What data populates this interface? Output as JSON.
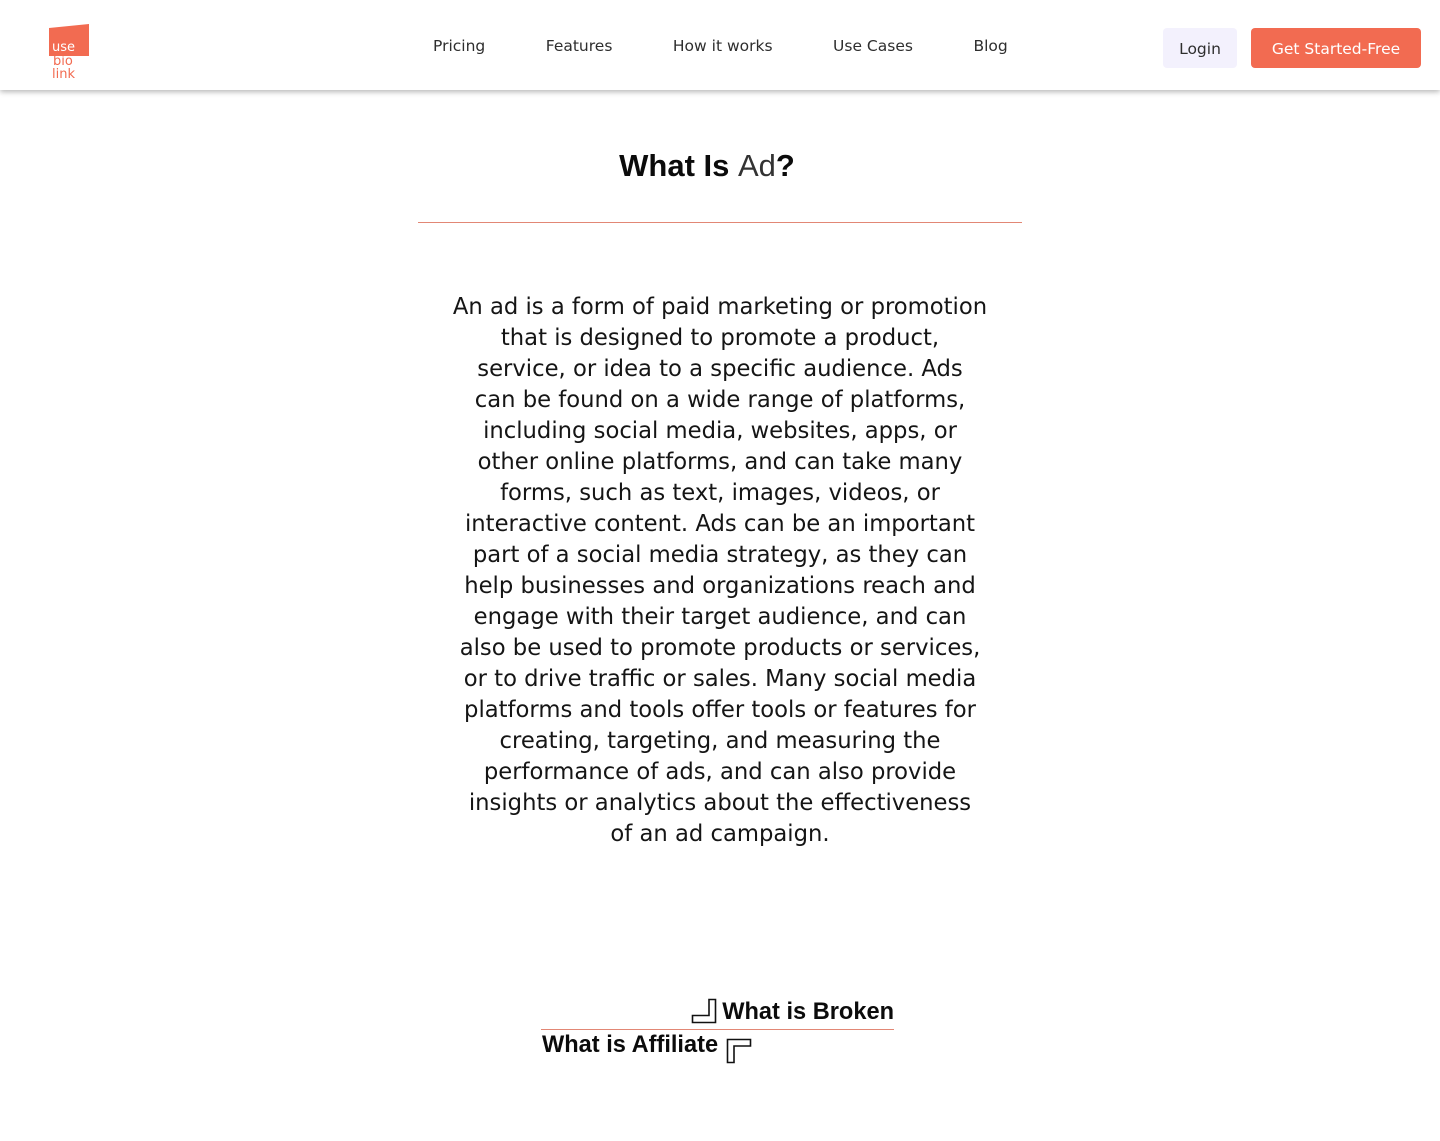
{
  "header": {
    "logo": {
      "line1": "use",
      "line2": "bio",
      "line3": "link"
    },
    "nav": [
      {
        "label": "Pricing"
      },
      {
        "label": "Features"
      },
      {
        "label": "How it works"
      },
      {
        "label": "Use Cases"
      },
      {
        "label": "Blog"
      }
    ],
    "login_label": "Login",
    "cta_label": "Get Started-Free"
  },
  "article": {
    "title": {
      "prefix": "What Is ",
      "term": "Ad",
      "suffix": "?"
    },
    "body_lines": [
      "An ad is a form of paid marketing or promotion",
      "that is designed to promote a product,",
      "service, or idea to a specific audience. Ads",
      "can be found on a wide range of platforms,",
      "including social media, websites, apps, or",
      "other online platforms, and can take many",
      "forms, such as text, images, videos, or",
      "interactive content. Ads can be an important",
      "part of a social media strategy, as they can",
      "help businesses and organizations reach and",
      "engage with their target audience, and can",
      "also be used to promote products or services,",
      "or to drive traffic or sales. Many social media",
      "platforms and tools offer tools or features for",
      "creating, targeting, and measuring the",
      "performance of ads, and can also provide",
      "insights or analytics about the effectiveness",
      "of an ad campaign."
    ]
  },
  "related_links": [
    {
      "label": "What is Broken",
      "icon": "corner-bottom-right-icon"
    },
    {
      "label": "What is Affiliate",
      "icon": "corner-top-left-icon"
    }
  ],
  "colors": {
    "accent": "#f26b51",
    "login_bg": "#f3f1fd",
    "divider": "#e28775",
    "text": "#111111"
  }
}
